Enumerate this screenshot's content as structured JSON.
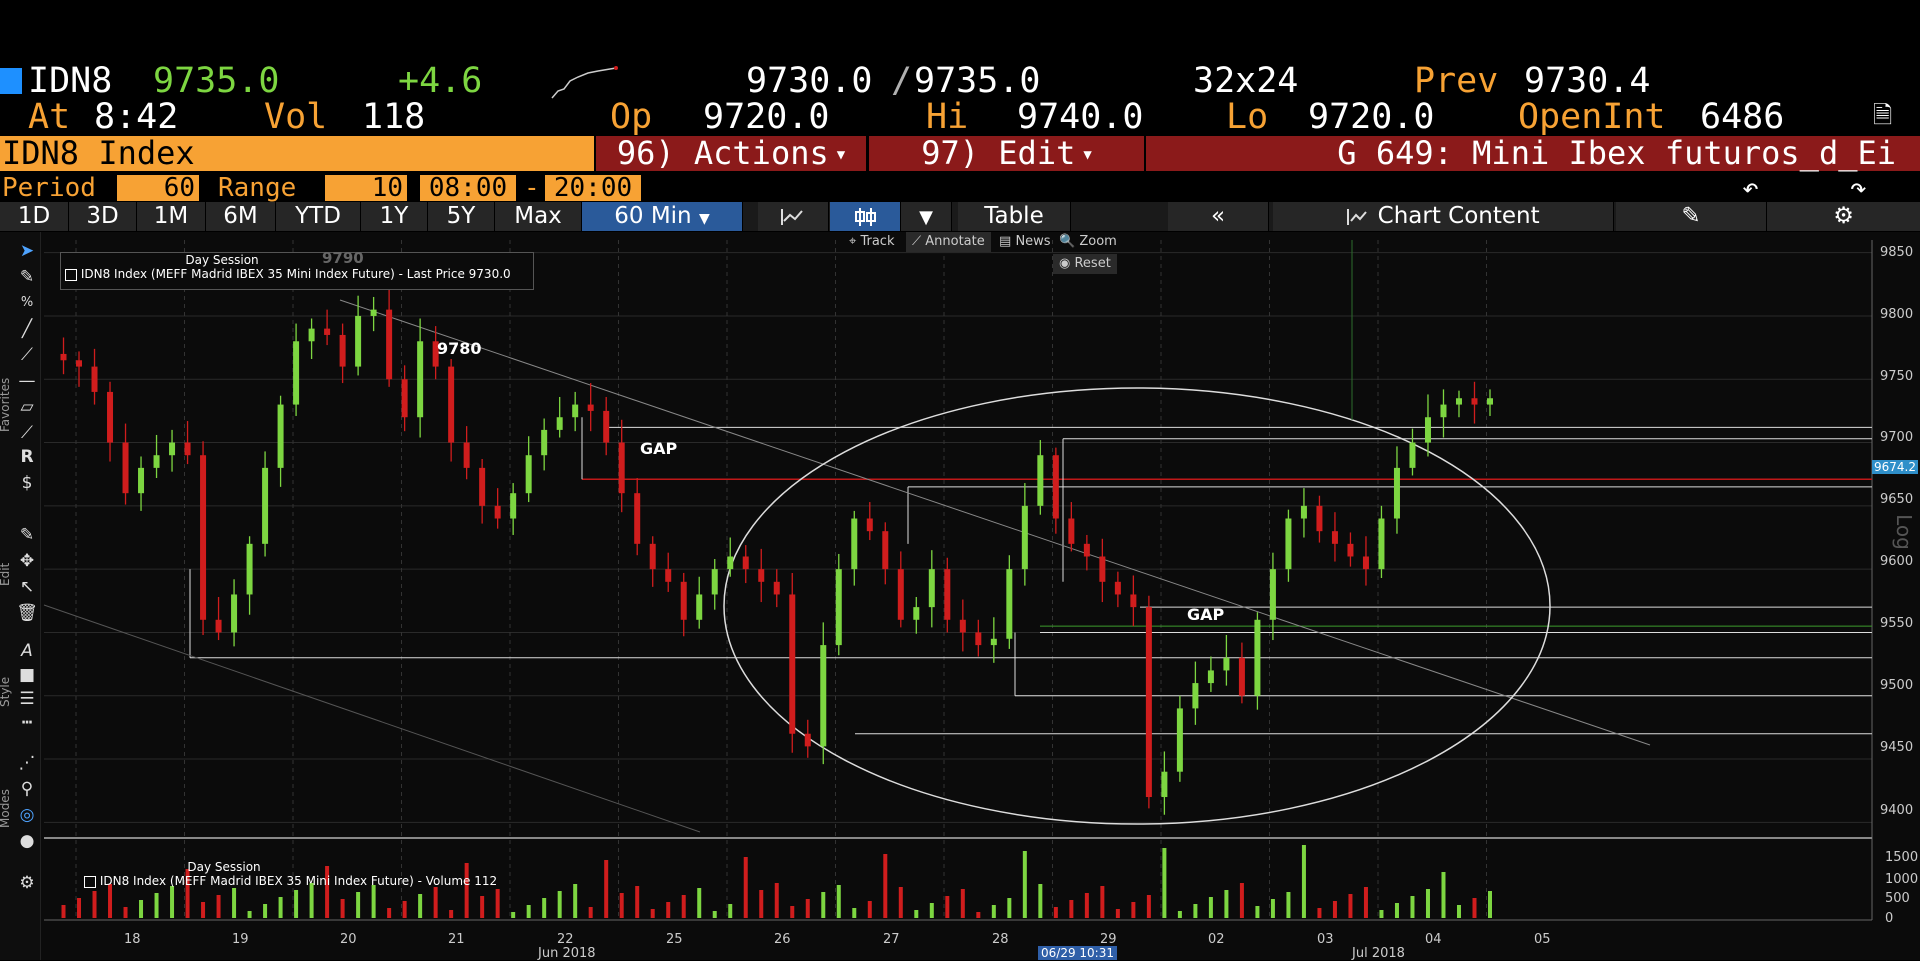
{
  "ticker": {
    "symbol": "IDN8",
    "last": "9735.0",
    "change": "+4.6",
    "bid_ask": "9730.0",
    "ask": "9735.0",
    "size": "32x24",
    "prev_label": "Prev",
    "prev": "9730.4",
    "at_label": "At",
    "time": "8:42",
    "vol_label": "Vol",
    "vol": "118",
    "op_label": "Op",
    "op": "9720.0",
    "hi_label": "Hi",
    "hi": "9740.0",
    "lo_label": "Lo",
    "lo": "9720.0",
    "oi_label": "OpenInt",
    "oi": "6486"
  },
  "header": {
    "title": "IDN8 Index",
    "actions": "96) Actions",
    "edit": "97) Edit",
    "page": "G 649: Mini Ibex futuros_d_Ei"
  },
  "period": {
    "period_label": "Period",
    "period_value": "60",
    "range_label": "Range",
    "range_value": "10",
    "start": "08:00",
    "dash": "-",
    "end": "20:00"
  },
  "range_buttons": [
    "1D",
    "3D",
    "1M",
    "6M",
    "YTD",
    "1Y",
    "5Y",
    "Max"
  ],
  "interval": "60 Min",
  "toolbar_right": {
    "table": "Table",
    "collapse": "«",
    "chart_content": "Chart Content"
  },
  "chart_tools": {
    "track": "Track",
    "annotate": "Annotate",
    "news": "News",
    "zoom": "Zoom",
    "reset": "Reset"
  },
  "sidebar_labels": {
    "favorites": "Favorites",
    "edit": "Edit",
    "style": "Style",
    "modes": "Modes"
  },
  "legend_main": {
    "session": "Day Session",
    "series": "IDN8 Index (MEFF Madrid IBEX 35 Mini Index Future) - Last Price 9730.0",
    "ghost": "9790"
  },
  "legend_vol": {
    "session": "Day Session",
    "series": "IDN8 Index (MEFF Madrid IBEX 35 Mini Index Future) - Volume 112"
  },
  "annotations": {
    "level": "9780",
    "gap1": "GAP",
    "gap2": "GAP"
  },
  "log_label": "Log",
  "price_axis": [
    "9850",
    "9800",
    "9750",
    "9700",
    "9650",
    "9600",
    "9550",
    "9500",
    "9450",
    "9400"
  ],
  "price_flag": "9674.2",
  "volume_axis": [
    "1500",
    "1000",
    "500",
    "0"
  ],
  "date_axis": [
    "18",
    "19",
    "20",
    "21",
    "22",
    "25",
    "26",
    "27",
    "28",
    "29",
    "02",
    "03",
    "04",
    "05"
  ],
  "month_labels": {
    "jun": "Jun 2018",
    "jul": "Jul 2018",
    "crosshair": "06/29 10:31"
  },
  "colors": {
    "up": "#7dd641",
    "down": "#d01d1d",
    "accent": "#f7a234",
    "bar": "#8b1a1a"
  },
  "chart_data": {
    "type": "candlestick",
    "ylim": [
      9390,
      9860
    ],
    "y_ticks": [
      9400,
      9450,
      9500,
      9550,
      9600,
      9650,
      9700,
      9750,
      9800,
      9850
    ],
    "x_categories": [
      "18",
      "19",
      "20",
      "21",
      "22",
      "25",
      "26",
      "27",
      "28",
      "29",
      "02",
      "03",
      "04",
      "05"
    ],
    "close_path": [
      9770,
      9765,
      9760,
      9740,
      9700,
      9660,
      9680,
      9690,
      9700,
      9690,
      9560,
      9550,
      9580,
      9620,
      9680,
      9730,
      9780,
      9790,
      9785,
      9760,
      9800,
      9805,
      9750,
      9720,
      9780,
      9760,
      9700,
      9680,
      9650,
      9640,
      9660,
      9690,
      9710,
      9720,
      9730,
      9725,
      9700,
      9660,
      9620,
      9600,
      9590,
      9560,
      9580,
      9600,
      9610,
      9600,
      9590,
      9580,
      9470,
      9460,
      9540,
      9600,
      9640,
      9630,
      9600,
      9560,
      9570,
      9600,
      9560,
      9550,
      9540,
      9545,
      9600,
      9650,
      9690,
      9640,
      9620,
      9610,
      9590,
      9580,
      9570,
      9420,
      9440,
      9490,
      9510,
      9520,
      9530,
      9500,
      9560,
      9600,
      9640,
      9650,
      9630,
      9620,
      9610,
      9600,
      9640,
      9680,
      9700,
      9720,
      9730,
      9735,
      9730,
      9735
    ],
    "volume_ticks": [
      0,
      500,
      1000,
      1500
    ]
  }
}
